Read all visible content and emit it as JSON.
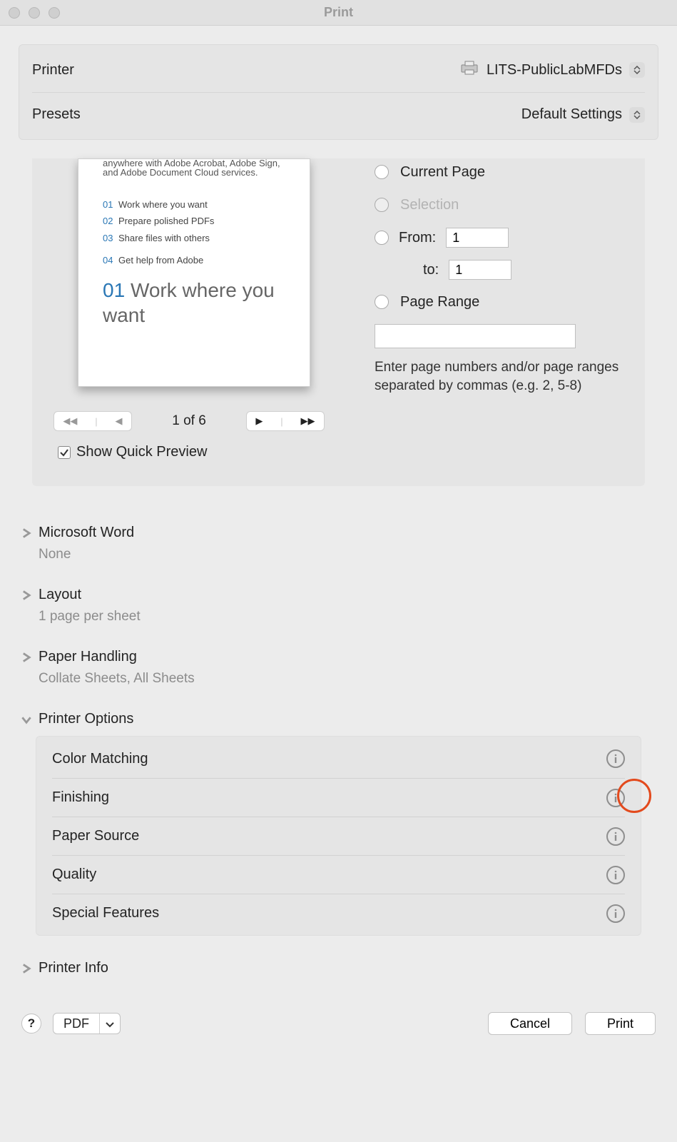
{
  "window": {
    "title": "Print"
  },
  "top": {
    "printer_label": "Printer",
    "printer_value": "LITS-PublicLabMFDs",
    "presets_label": "Presets",
    "presets_value": "Default Settings"
  },
  "preview": {
    "doc_line1": "anywhere with Adobe Acrobat, Adobe Sign,",
    "doc_line2": "and Adobe Document Cloud services.",
    "toc": [
      {
        "n": "01",
        "t": "Work where you want"
      },
      {
        "n": "02",
        "t": "Prepare polished PDFs"
      },
      {
        "n": "03",
        "t": "Share files with others"
      },
      {
        "n": "04",
        "t": "Get help from Adobe"
      }
    ],
    "heading_num": "01",
    "heading_text": "Work where you want",
    "page_indicator": "1 of 6",
    "show_quick_preview": "Show Quick Preview"
  },
  "range": {
    "current_page": "Current Page",
    "selection": "Selection",
    "from_label": "From:",
    "from_value": "1",
    "to_label": "to:",
    "to_value": "1",
    "page_range": "Page Range",
    "range_value": "",
    "hint": "Enter page numbers and/or page ranges separated by commas (e.g. 2, 5-8)"
  },
  "sections": {
    "ms_word": {
      "title": "Microsoft Word",
      "sub": "None"
    },
    "layout": {
      "title": "Layout",
      "sub": "1 page per sheet"
    },
    "paper_handling": {
      "title": "Paper Handling",
      "sub": "Collate Sheets, All Sheets"
    },
    "printer_options": {
      "title": "Printer Options",
      "items": [
        "Color Matching",
        "Finishing",
        "Paper Source",
        "Quality",
        "Special Features"
      ]
    },
    "printer_info": {
      "title": "Printer Info"
    }
  },
  "footer": {
    "pdf": "PDF",
    "cancel": "Cancel",
    "print": "Print"
  }
}
